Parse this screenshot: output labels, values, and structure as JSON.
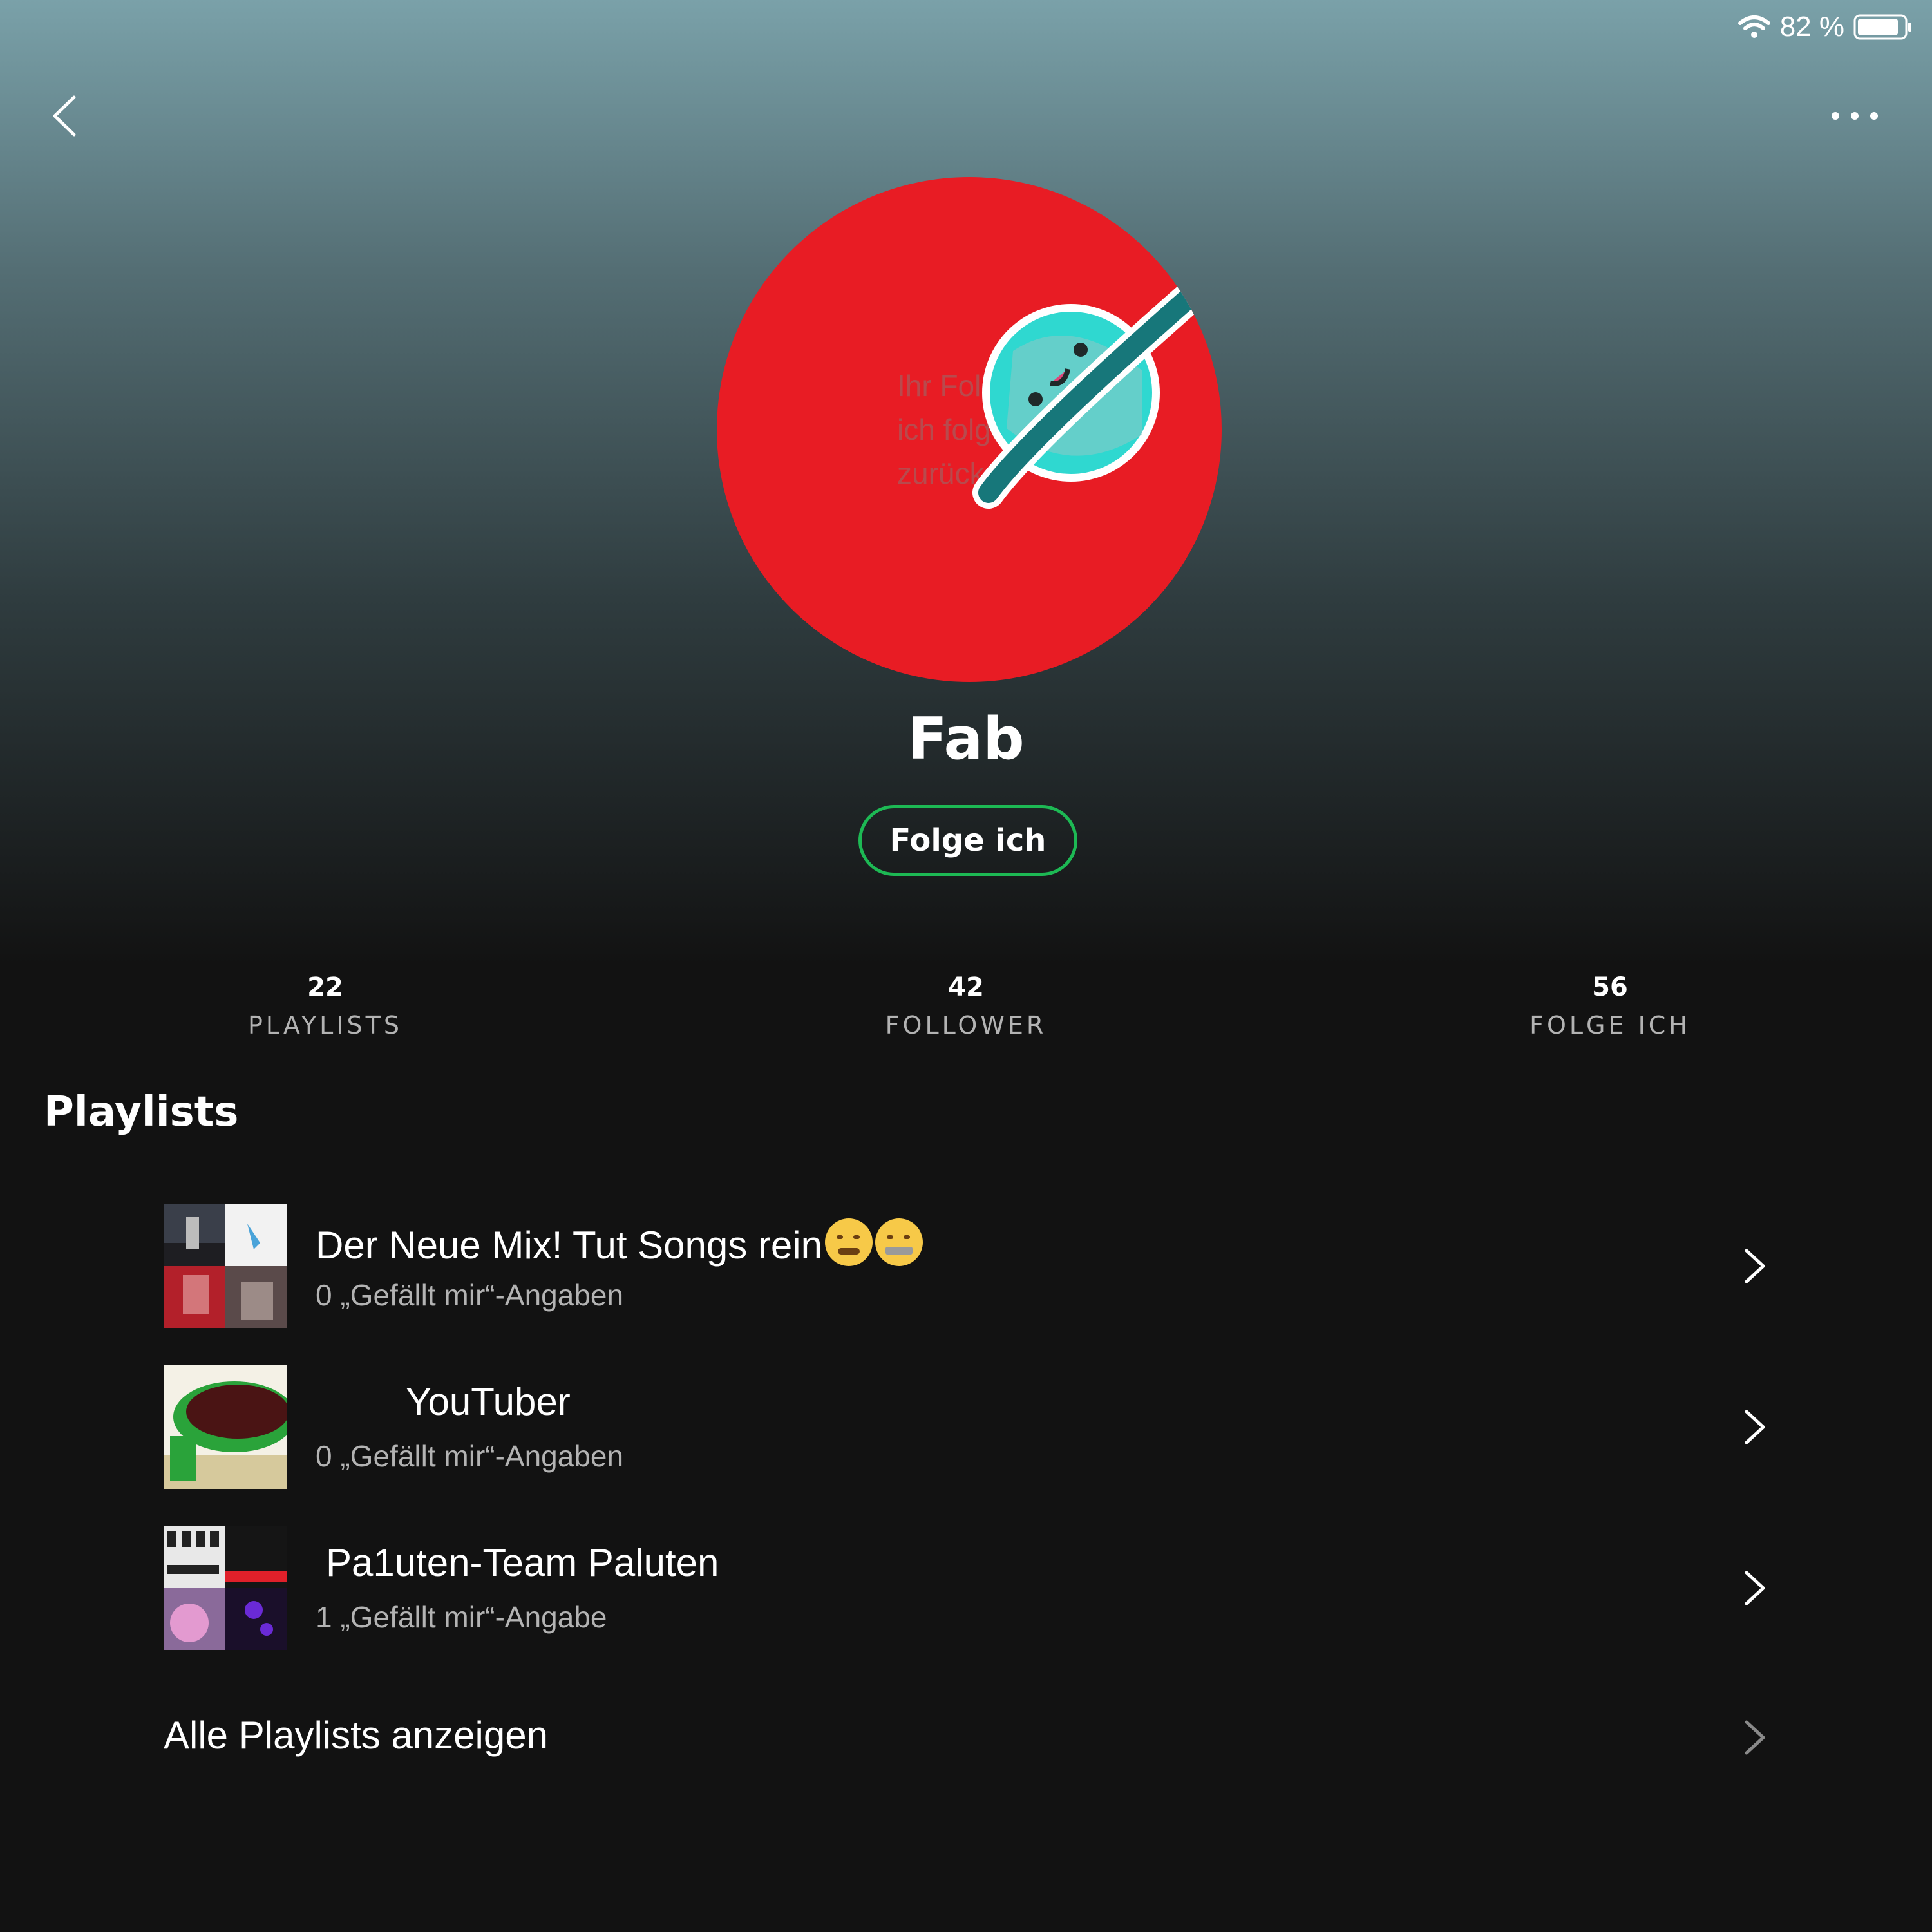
{
  "status_bar": {
    "battery_text": "82 %",
    "wifi_icon": "wifi-icon",
    "battery_icon": "battery-icon"
  },
  "nav": {
    "back_icon": "chevron-left-icon",
    "more_icon": "more-horizontal-icon"
  },
  "profile": {
    "avatar_text": "Ihr Folgt\nich folge\nzurück",
    "avatar_color": "#e81c24",
    "name": "Fab",
    "follow_button_label": "Folge ich",
    "accent_color": "#1db954"
  },
  "stats": [
    {
      "value": "22",
      "label": "PLAYLISTS"
    },
    {
      "value": "42",
      "label": "FOLLOWER"
    },
    {
      "value": "56",
      "label": "FOLGE ICH"
    }
  ],
  "playlists_section": {
    "title": "Playlists",
    "items": [
      {
        "title": "Der Neue Mix! Tut Songs rein",
        "subtitle": "0 „Gefällt mir“-Angaben"
      },
      {
        "title": "YouTuber",
        "subtitle": "0 „Gefällt mir“-Angaben"
      },
      {
        "title": "Pa1uten-Team Paluten",
        "subtitle": "1 „Gefällt mir“-Angabe"
      }
    ],
    "show_all_label": "Alle Playlists anzeigen"
  }
}
